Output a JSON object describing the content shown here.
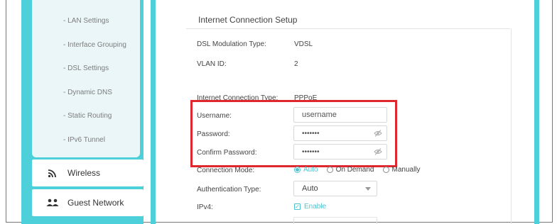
{
  "sidebar": {
    "submenu": [
      "- LAN Settings",
      "- Interface Grouping",
      "- DSL Settings",
      "- Dynamic DNS",
      "- Static Routing",
      "- IPv6 Tunnel"
    ],
    "nav": [
      {
        "label": "Wireless",
        "icon": "wifi-icon"
      },
      {
        "label": "Guest Network",
        "icon": "guest-users-icon"
      }
    ]
  },
  "main": {
    "section_title": "Internet Connection Setup",
    "modulation": {
      "label": "DSL Modulation Type:",
      "value": "VDSL"
    },
    "vlan": {
      "label": "VLAN ID:",
      "value": "2"
    },
    "connection_type": {
      "label": "Internet Connection Type:",
      "value": "PPPoE"
    },
    "username": {
      "label": "Username:",
      "value": "username"
    },
    "password": {
      "label": "Password:",
      "value": "•••••••"
    },
    "confirm_password": {
      "label": "Confirm Password:",
      "value": "•••••••"
    },
    "connection_mode": {
      "label": "Connection Mode:",
      "options": [
        "Auto",
        "On Demand",
        "Manually"
      ],
      "selected": "Auto"
    },
    "auth_type": {
      "label": "Authentication Type:",
      "value": "Auto"
    },
    "ipv4": {
      "label": "IPv4:",
      "checkbox_label": "Enable",
      "checked": true
    }
  },
  "colors": {
    "accent": "#4dd0d9",
    "highlight": "#e0262f"
  }
}
